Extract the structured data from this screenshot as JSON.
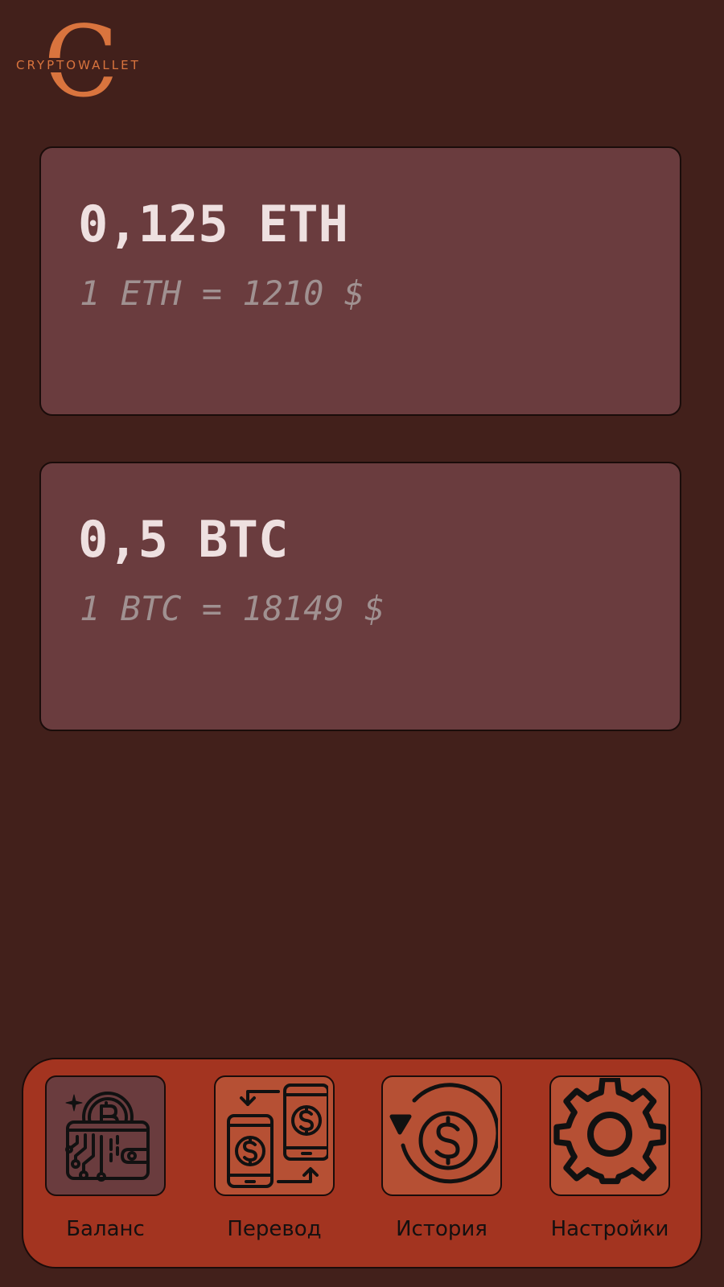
{
  "logo": {
    "letter": "C",
    "wordmark": "CRYPTOWALLET"
  },
  "wallets": [
    {
      "amount": "0,125 ETH",
      "rate": "1 ETH = 1210 $"
    },
    {
      "amount": "0,5 BTC",
      "rate": "1 BTC = 18149 $"
    }
  ],
  "nav": {
    "items": [
      {
        "label": "Баланс",
        "icon": "bitcoin-wallet-icon",
        "active": true
      },
      {
        "label": "Перевод",
        "icon": "transfer-icon",
        "active": false
      },
      {
        "label": "История",
        "icon": "history-icon",
        "active": false
      },
      {
        "label": "Настройки",
        "icon": "gear-icon",
        "active": false
      }
    ]
  },
  "colors": {
    "background": "#42201b",
    "card": "#6a3c3e",
    "accent": "#d9743e",
    "navbar": "#a33420",
    "nav_tile": "#b65034"
  }
}
